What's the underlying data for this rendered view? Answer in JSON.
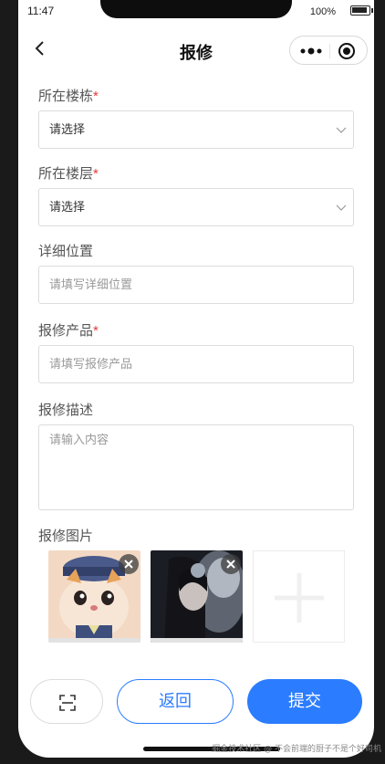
{
  "status_bar": {
    "time": "11:47",
    "battery": "100%"
  },
  "nav": {
    "title": "报修"
  },
  "form": {
    "building": {
      "label": "所在楼栋",
      "required_mark": "*",
      "value": "请选择"
    },
    "floor": {
      "label": "所在楼层",
      "required_mark": "*",
      "value": "请选择"
    },
    "location": {
      "label": "详细位置",
      "placeholder": "请填写详细位置"
    },
    "product": {
      "label": "报修产品",
      "required_mark": "*",
      "placeholder": "请填写报修产品"
    },
    "description": {
      "label": "报修描述",
      "placeholder": "请输入内容"
    },
    "images": {
      "label": "报修图片"
    }
  },
  "actions": {
    "back_label": "返回",
    "submit_label": "提交"
  },
  "watermark": "掘金技术社区 @ 不会前端的厨子不是个好司机",
  "colors": {
    "primary": "#2b7cff",
    "required": "#e33a3a"
  },
  "icons": [
    "back-icon",
    "more-icon",
    "target-icon",
    "chevron-down-icon",
    "close-icon",
    "plus-icon",
    "scan-icon"
  ]
}
